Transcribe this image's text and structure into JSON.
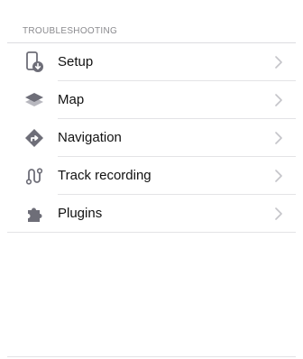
{
  "section": {
    "title": "TROUBLESHOOTING"
  },
  "items": [
    {
      "label": "Setup",
      "icon": "setup-icon"
    },
    {
      "label": "Map",
      "icon": "map-layers-icon"
    },
    {
      "label": "Navigation",
      "icon": "navigation-icon"
    },
    {
      "label": "Track recording",
      "icon": "track-recording-icon"
    },
    {
      "label": "Plugins",
      "icon": "plugins-icon"
    }
  ],
  "colors": {
    "icon": "#6e6e78",
    "chevron": "#c4c4c9",
    "header_text": "#8a8a8e",
    "divider": "#e3e3e6"
  }
}
